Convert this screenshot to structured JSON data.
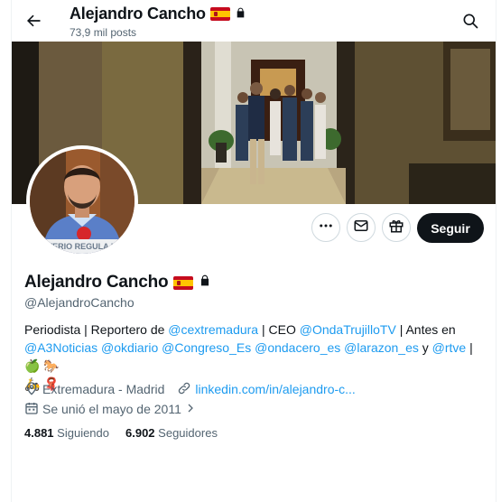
{
  "header": {
    "name": "Alejandro Cancho",
    "posts": "73,9 mil posts"
  },
  "profile": {
    "name": "Alejandro Cancho",
    "handle": "@AlejandroCancho",
    "follow_label": "Seguir",
    "bio": {
      "t1": "Periodista | Reportero de ",
      "l1": "@cextremadura",
      "t2": " | CEO ",
      "l2": "@OndaTrujilloTV",
      "t3": " | Antes en ",
      "l3": "@A3Noticias",
      "t4": " ",
      "l4": "@okdiario",
      "t5": " ",
      "l5": "@Congreso_Es",
      "t6": " ",
      "l6": "@ondacero_es",
      "t7": " ",
      "l7": "@larazon_es",
      "t8": " y ",
      "l8": "@rtve",
      "t9": " | ",
      "emoji1": "🍏",
      "emoji2": "🐎",
      "emoji3": "🛵",
      "emoji4": "🧣"
    },
    "location": "Extremadura - Madrid",
    "website": "linkedin.com/in/alejandro-c...",
    "joined": "Se unió el mayo de 2011",
    "following_count": "4.881",
    "following_label": "Siguiendo",
    "followers_count": "6.902",
    "followers_label": "Seguidores"
  },
  "avatar_caption": "STERIO REGULA LO",
  "icons": [
    "back-arrow-icon",
    "search-icon",
    "flag-spain-icon",
    "lock-icon",
    "more-icon",
    "mail-icon",
    "gift-icon",
    "location-icon",
    "link-icon",
    "calendar-icon",
    "chevron-right-icon"
  ],
  "colors": {
    "accent": "#1d9bf0",
    "text": "#0f1419",
    "muted": "#536471",
    "button": "#0f1419",
    "border": "#cfd9de"
  }
}
